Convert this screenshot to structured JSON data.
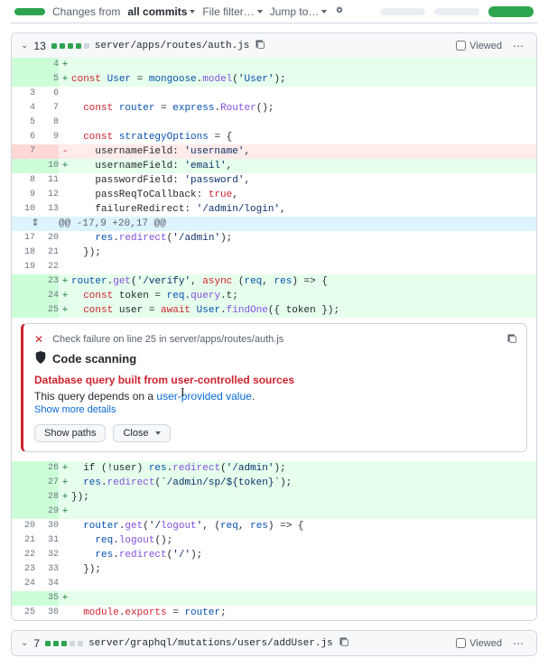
{
  "topbar": {
    "changes_from": "Changes from",
    "all_commits": "all commits",
    "file_filter": "File filter…",
    "jump_to": "Jump to…"
  },
  "file1": {
    "count": "13",
    "path": "server/apps/routes/auth.js",
    "viewed_label": "Viewed",
    "lines": [
      {
        "l": "",
        "r": "4",
        "t": "add",
        "code": ""
      },
      {
        "l": "",
        "r": "5",
        "t": "add",
        "code": "const User = mongoose.model('User');"
      },
      {
        "l": "3",
        "r": "6",
        "t": "ctx",
        "code": ""
      },
      {
        "l": "4",
        "r": "7",
        "t": "ctx",
        "code": "  const router = express.Router();"
      },
      {
        "l": "5",
        "r": "8",
        "t": "ctx",
        "code": ""
      },
      {
        "l": "6",
        "r": "9",
        "t": "ctx",
        "code": "  const strategyOptions = {"
      },
      {
        "l": "7",
        "r": "",
        "t": "del",
        "code": "    usernameField: 'username',"
      },
      {
        "l": "",
        "r": "10",
        "t": "add",
        "code": "    usernameField: 'email',"
      },
      {
        "l": "8",
        "r": "11",
        "t": "ctx",
        "code": "    passwordField: 'password',"
      },
      {
        "l": "9",
        "r": "12",
        "t": "ctx",
        "code": "    passReqToCallback: true,"
      },
      {
        "l": "10",
        "r": "13",
        "t": "ctx",
        "code": "    failureRedirect: '/admin/login',"
      }
    ],
    "hunk": "@@ -17,9 +20,17 @@",
    "lines2": [
      {
        "l": "17",
        "r": "20",
        "t": "ctx",
        "code": "    res.redirect('/admin');"
      },
      {
        "l": "18",
        "r": "21",
        "t": "ctx",
        "code": "  });"
      },
      {
        "l": "19",
        "r": "22",
        "t": "ctx",
        "code": ""
      },
      {
        "l": "",
        "r": "23",
        "t": "add",
        "code": "+ router.get('/verify', async (req, res) => {"
      },
      {
        "l": "",
        "r": "24",
        "t": "add",
        "code": "+   const token = req.query.t;"
      },
      {
        "l": "",
        "r": "25",
        "t": "add",
        "code": "+   const user = await User.findOne({ token });"
      }
    ],
    "lines3": [
      {
        "l": "",
        "r": "26",
        "t": "add",
        "code": "+   if (!user) res.redirect('/admin');"
      },
      {
        "l": "",
        "r": "27",
        "t": "add",
        "code": "+   res.redirect(`/admin/sp/${token}`);"
      },
      {
        "l": "",
        "r": "28",
        "t": "add",
        "code": "+ });"
      },
      {
        "l": "",
        "r": "29",
        "t": "add",
        "code": "+"
      },
      {
        "l": "20",
        "r": "30",
        "t": "ctx",
        "code": "  router.get('/logout', (req, res) => {"
      },
      {
        "l": "21",
        "r": "31",
        "t": "ctx",
        "code": "    req.logout();"
      },
      {
        "l": "22",
        "r": "32",
        "t": "ctx",
        "code": "    res.redirect('/');"
      },
      {
        "l": "23",
        "r": "33",
        "t": "ctx",
        "code": "  });"
      },
      {
        "l": "24",
        "r": "34",
        "t": "ctx",
        "code": ""
      },
      {
        "l": "",
        "r": "35",
        "t": "add",
        "code": "+"
      },
      {
        "l": "25",
        "r": "36",
        "t": "ctx",
        "code": "  module.exports = router;"
      }
    ]
  },
  "alert": {
    "topline": "Check failure on line 25 in server/apps/routes/auth.js",
    "scanner": "Code scanning",
    "heading": "Database query built from user-controlled sources",
    "body_pre": "This query depends on a ",
    "body_link": "user-provided value",
    "body_post": ".",
    "more": "Show more details",
    "show_paths": "Show paths",
    "close": "Close"
  },
  "file2": {
    "count": "7",
    "path": "server/graphql/mutations/users/addUser.js",
    "viewed_label": "Viewed"
  }
}
